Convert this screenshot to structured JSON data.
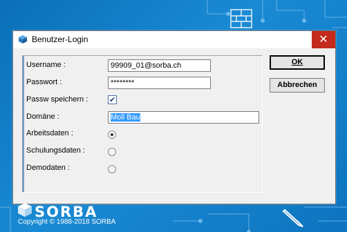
{
  "window": {
    "title": "Benutzer-Login",
    "close_glyph": "✕"
  },
  "form": {
    "username_label": "Username :",
    "username_value": "99909_01@sorba.ch",
    "password_label": "Passwort :",
    "password_value": "********",
    "save_password_label": "Passw speichern :",
    "save_password_checked": true,
    "domain_label": "Domäne :",
    "domain_value": "Moll Bau",
    "work_data_label": "Arbeitsdaten :",
    "training_data_label": "Schulungsdaten :",
    "demo_data_label": "Demodaten :",
    "selected_dataset": "Arbeitsdaten"
  },
  "buttons": {
    "ok_label": "OK",
    "cancel_label": "Abbrechen"
  },
  "branding": {
    "logo_text": "SORBA",
    "copyright": "Copyright © 1988-2018 SORBA",
    "brand_color": "#0a6fb8"
  }
}
